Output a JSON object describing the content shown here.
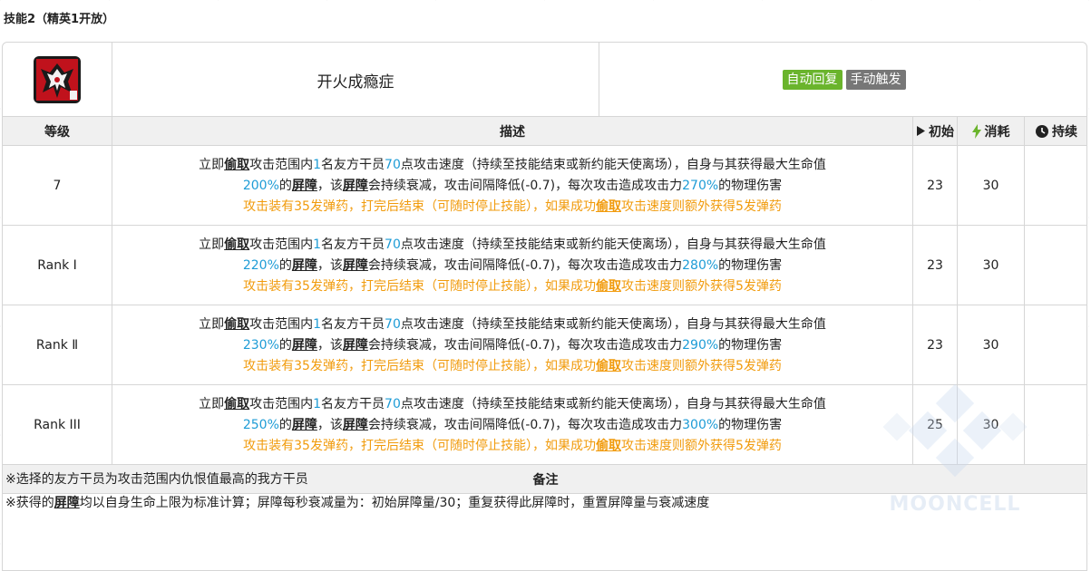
{
  "section_title": "技能2（精英1开放）",
  "skill": {
    "name": "开火成瘾症",
    "icon": "skill-icon-red-demon",
    "tags": [
      {
        "label": "自动回复",
        "color": "#6ab42c"
      },
      {
        "label": "手动触发",
        "color": "#777777"
      }
    ]
  },
  "headers": {
    "level": "等级",
    "description": "描述",
    "initial": "初始",
    "cost": "消耗",
    "duration": "持续"
  },
  "desc_parts": {
    "p1": "立即",
    "kw_steal": "偷取",
    "p2": "攻击范围内",
    "num_targets": "1",
    "p3": "名友方干员",
    "num_speed": "70",
    "p4": "点攻击速度（持续至技能结束或新约能天使离场），自身与其获得最大生命值",
    "kw_barrier": "屏障",
    "p5": "，该",
    "p6": "会持续衰减，攻击间隔降低(-0.7)，每次攻击造成攻击力",
    "p7": "的物理伤害",
    "o1": "攻击装有35发弹药，打完后结束（可随时停止技能），如果成功",
    "o2": "攻击速度则额外获得5发弹药"
  },
  "rows": [
    {
      "level": "7",
      "hp": "200%",
      "atk": "270%",
      "initial": "23",
      "cost": "30",
      "duration": ""
    },
    {
      "level": "Rank Ⅰ",
      "hp": "220%",
      "atk": "280%",
      "initial": "23",
      "cost": "30",
      "duration": ""
    },
    {
      "level": "Rank Ⅱ",
      "hp": "230%",
      "atk": "290%",
      "initial": "23",
      "cost": "30",
      "duration": ""
    },
    {
      "level": "Rank III",
      "hp": "250%",
      "atk": "300%",
      "initial": "25",
      "cost": "30",
      "duration": ""
    }
  ],
  "notes": {
    "title": "备注",
    "line1": "※选择的友方干员为攻击范围内仇恨值最高的我方干员",
    "line2_pre": "※获得的",
    "line2_kw": "屏障",
    "line2_post": "均以自身生命上限为标准计算；屏障每秒衰减量为：初始屏障量/30；重复获得此屏障时，重置屏障量与衰减速度"
  },
  "watermark": "MOONCELL",
  "colors": {
    "blue": "#1e9cd6",
    "orange": "#f19b0c",
    "header_bg": "#f0f0f0",
    "border": "#d6d6d6"
  }
}
